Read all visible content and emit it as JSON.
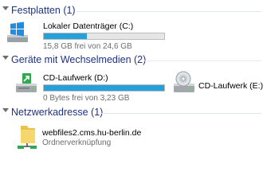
{
  "groups": [
    {
      "title": "Festplatten (1)",
      "items": [
        {
          "name": "Lokaler Datenträger (C:)",
          "free": "15,8 GB frei von 24,6 GB",
          "used_fraction": 0.36,
          "icon": "windows-drive-icon"
        }
      ]
    },
    {
      "title": "Geräte mit Wechselmedien (2)",
      "items": [
        {
          "name": "CD-Laufwerk (D:)",
          "free": "0 Bytes frei von 3,23 GB",
          "used_fraction": 1.0,
          "icon": "dvd-rw-drive-icon"
        },
        {
          "name": "CD-Laufwerk (E:)",
          "icon": "cd-drive-icon"
        }
      ]
    },
    {
      "title": "Netzwerkadresse (1)",
      "items": [
        {
          "name": "webfiles2.cms.hu-berlin.de",
          "type": "Ordnerverknüpfung",
          "icon": "network-folder-icon"
        }
      ]
    }
  ],
  "colors": {
    "group_title": "#1e3287",
    "bar_fill": "#26a0da",
    "subtext": "#6d6d6d"
  }
}
